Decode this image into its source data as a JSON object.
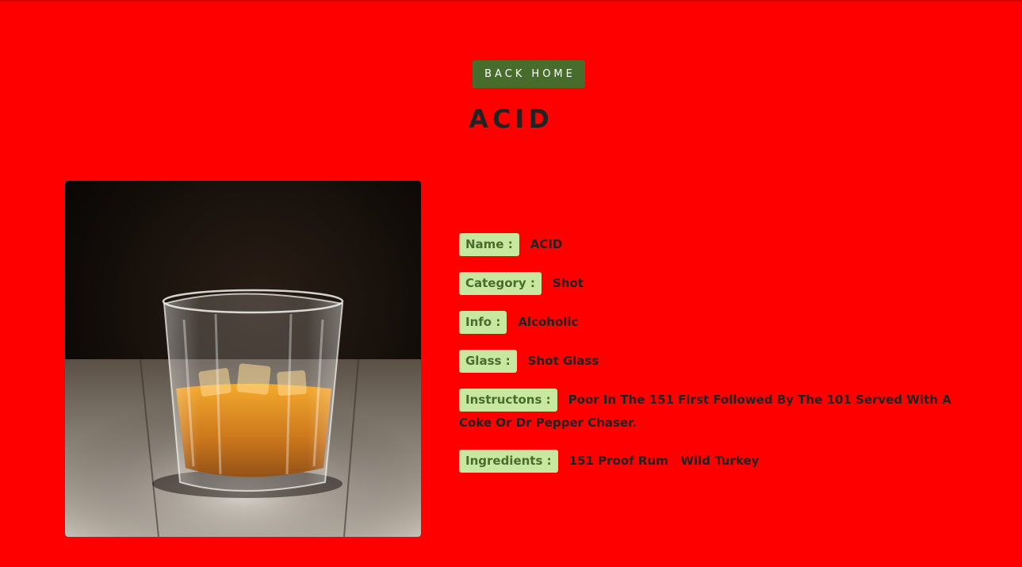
{
  "back_button": {
    "label": "Back Home"
  },
  "title": "ACID",
  "image": {
    "alt": "ACID"
  },
  "details": [
    {
      "label": "Name :",
      "value": "ACID"
    },
    {
      "label": "Category :",
      "value": "Shot"
    },
    {
      "label": "Info :",
      "value": "Alcoholic"
    },
    {
      "label": "Glass :",
      "value": "Shot Glass"
    },
    {
      "label": "Instructons :",
      "value": "Poor In The 151 First Followed By The 101 Served With A Coke Or Dr Pepper Chaser."
    },
    {
      "label": "Ingredients :",
      "value": "151 Proof Rum   Wild Turkey"
    }
  ],
  "colors": {
    "background": "#ff0000",
    "button": "#476c2b",
    "label_bg": "#c8e8a0",
    "label_text": "#476c2b",
    "text": "#222222"
  }
}
